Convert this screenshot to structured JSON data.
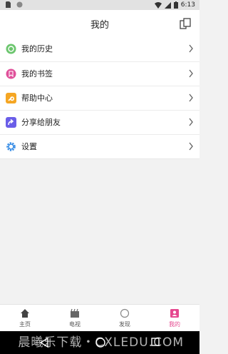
{
  "status_bar": {
    "time": "6:13",
    "icons": [
      "sim-icon",
      "record-icon",
      "wifi-icon",
      "signal-icon",
      "battery-icon"
    ]
  },
  "header": {
    "title": "我的",
    "action_icon": "copy-icon"
  },
  "menu": [
    {
      "label": "我的历史",
      "icon": "history-icon",
      "color": "#6cc66e"
    },
    {
      "label": "我的书签",
      "icon": "bookmark-icon",
      "color": "#e0509a"
    },
    {
      "label": "帮助中心",
      "icon": "wrench-icon",
      "color": "#f5a623"
    },
    {
      "label": "分享给朋友",
      "icon": "share-icon",
      "color": "#6a5ee8"
    },
    {
      "label": "设置",
      "icon": "gear-icon",
      "color": "#3a8ee6"
    }
  ],
  "tabbar": [
    {
      "label": "主页",
      "icon": "home-icon"
    },
    {
      "label": "电视",
      "icon": "tv-icon"
    },
    {
      "label": "发现",
      "icon": "discover-icon"
    },
    {
      "label": "我的",
      "icon": "profile-icon",
      "active": true
    }
  ],
  "colors": {
    "accent": "#e5488f"
  },
  "watermark": "晨曦乐下载・CXLEDU.COM"
}
